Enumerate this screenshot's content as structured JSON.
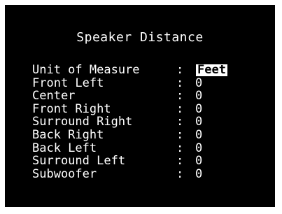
{
  "screen": {
    "title": "Speaker Distance",
    "rows": [
      {
        "label": "Unit of Measure",
        "separator": ":",
        "value": "Feet",
        "selected": true
      },
      {
        "label": "Front Left",
        "separator": ":",
        "value": "0"
      },
      {
        "label": "Center",
        "separator": ":",
        "value": "0"
      },
      {
        "label": "Front Right",
        "separator": ":",
        "value": "0"
      },
      {
        "label": "Surround Right",
        "separator": ":",
        "value": "0"
      },
      {
        "label": "Back Right",
        "separator": ":",
        "value": "0"
      },
      {
        "label": "Back Left",
        "separator": ":",
        "value": "0"
      },
      {
        "label": "Surround Left",
        "separator": ":",
        "value": "0"
      },
      {
        "label": "Subwoofer",
        "separator": ":",
        "value": "0"
      }
    ]
  },
  "colors": {
    "background": "#000000",
    "text": "#ffffff",
    "highlight_background": "#ffffff",
    "highlight_text": "#000000",
    "frame": "#ffffff"
  }
}
